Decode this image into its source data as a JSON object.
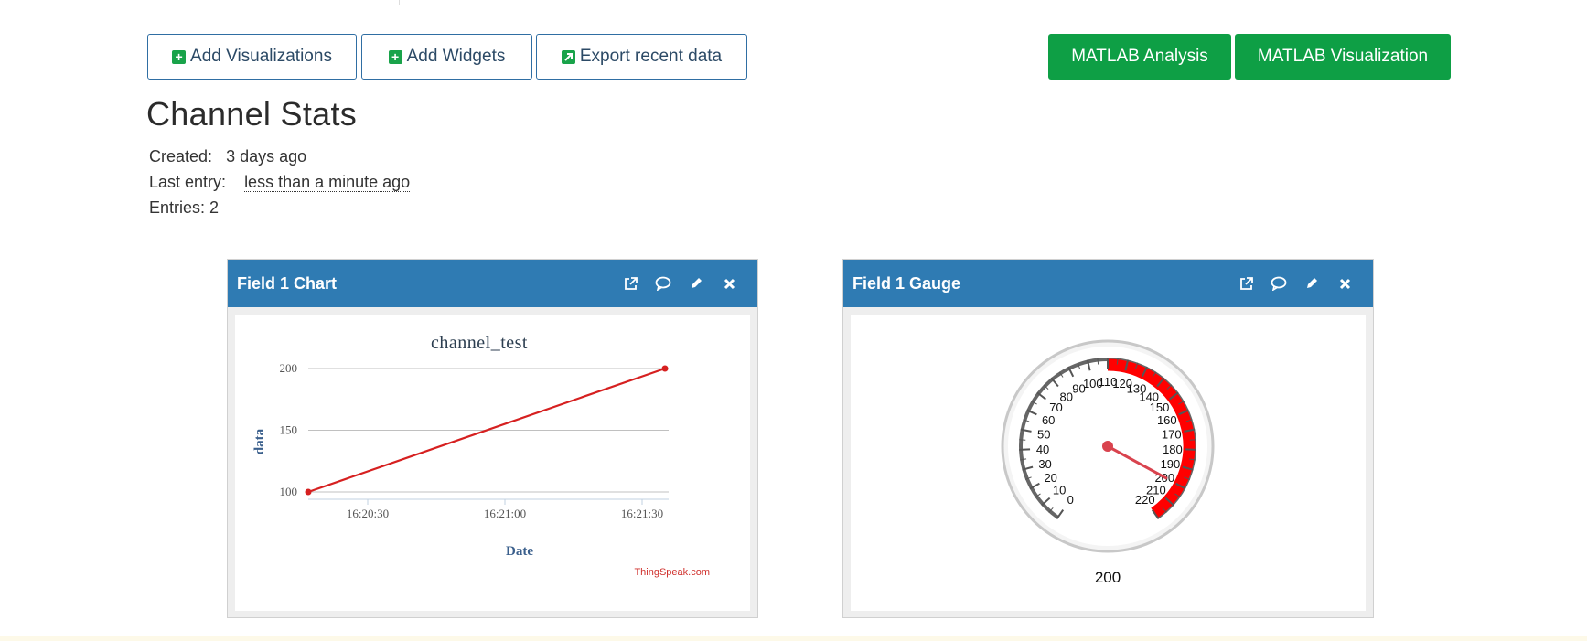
{
  "toolbar": {
    "add_visualizations": "Add Visualizations",
    "add_widgets": "Add Widgets",
    "export_recent_data": "Export recent data",
    "matlab_analysis": "MATLAB Analysis",
    "matlab_visualization": "MATLAB Visualization"
  },
  "channel_stats": {
    "title": "Channel Stats",
    "created_label": "Created:",
    "created_value": "3 days ago",
    "last_entry_label": "Last entry:",
    "last_entry_value": "less than a minute ago",
    "entries_text": "Entries: 2"
  },
  "panels": {
    "chart": {
      "title": "Field 1 Chart"
    },
    "gauge": {
      "title": "Field 1 Gauge"
    }
  },
  "chart_data": [
    {
      "type": "line",
      "title": "channel_test",
      "xlabel": "Date",
      "ylabel": "data",
      "credit": "ThingSpeak.com",
      "x_ticks": [
        "16:20:30",
        "16:21:00",
        "16:21:30"
      ],
      "y_ticks": [
        100,
        150,
        200
      ],
      "ylim": [
        100,
        200
      ],
      "series": [
        {
          "x": [
            "16:20:17",
            "16:21:35"
          ],
          "values": [
            100,
            200
          ],
          "color": "#d62020"
        }
      ],
      "grid": true
    },
    {
      "type": "gauge",
      "min": 0,
      "max": 220,
      "tick_labels": [
        0,
        10,
        20,
        30,
        40,
        50,
        60,
        70,
        80,
        90,
        100,
        110,
        120,
        130,
        140,
        150,
        160,
        170,
        180,
        190,
        200,
        210,
        220
      ],
      "red_band": [
        110,
        220
      ],
      "value": 200,
      "value_label": "200",
      "colors": {
        "band": "#ff0000",
        "needle": "#d9434e"
      }
    }
  ],
  "icons": {
    "panel_actions": [
      "external-link-icon",
      "comment-icon",
      "pencil-icon",
      "close-icon"
    ]
  }
}
